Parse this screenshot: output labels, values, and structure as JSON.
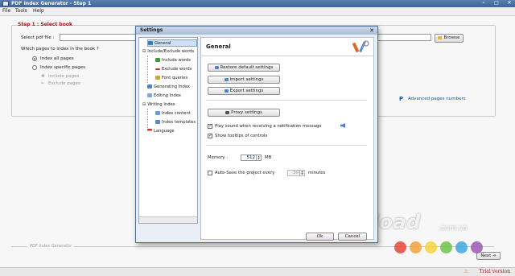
{
  "window": {
    "title": "PDF Index Generator - Step 1"
  },
  "menu": [
    "File",
    "Tools",
    "Help"
  ],
  "step": {
    "title": "Step 1 : Select book",
    "pdf_label": "Select pdf file :",
    "browse_label": "Browse",
    "pages_question": "Which pages to index in the book ?",
    "opt_all": "Index all pages",
    "opt_specific": "Index specific pages",
    "include_pages": "Include pages",
    "exclude_pages": "Exclude pages",
    "advanced_label": "Advanced pages numbers"
  },
  "footer": {
    "group_label": "PDF Index Generator",
    "next_label": "Next",
    "status_text": "Trial version"
  },
  "settings": {
    "title": "Settings",
    "tree": {
      "general": "General",
      "include_exclude": "Include/Exclude words",
      "include_words": "Include words",
      "exclude_words": "Exclude words",
      "font_queries": "Font queries",
      "generating_index": "Generating Index",
      "editing_index": "Editing Index",
      "writing_index": "Writing Index",
      "index_content": "Index content",
      "index_templates": "Index templates",
      "language": "Language"
    },
    "panel": {
      "header": "General",
      "restore": "Restore default settings",
      "import": "Import settings",
      "export": "Export settings",
      "proxy": "Proxy settings",
      "play_sound": "Play sound when receiving a notification message",
      "show_tooltips": "Show tooltips of controls",
      "memory_label": "Memory :",
      "memory_value": "512",
      "memory_unit": "MB",
      "autosave_label": "Auto-Save the project every",
      "autosave_value": "30",
      "autosave_unit": "minutes"
    },
    "ok_label": "Ok",
    "cancel_label": "Cancel"
  },
  "watermark": {
    "brand": "Download",
    "domain": ".com.vn"
  },
  "colors": {
    "titlebar": "#3e6597",
    "step_title": "#b1131a",
    "link": "#1b4fb0",
    "trial": "#a3141a",
    "watermark_dots": [
      "#e8453c",
      "#f4a23a",
      "#f6d33d",
      "#6cc24a",
      "#3fa7e0",
      "#9b59b6"
    ]
  }
}
